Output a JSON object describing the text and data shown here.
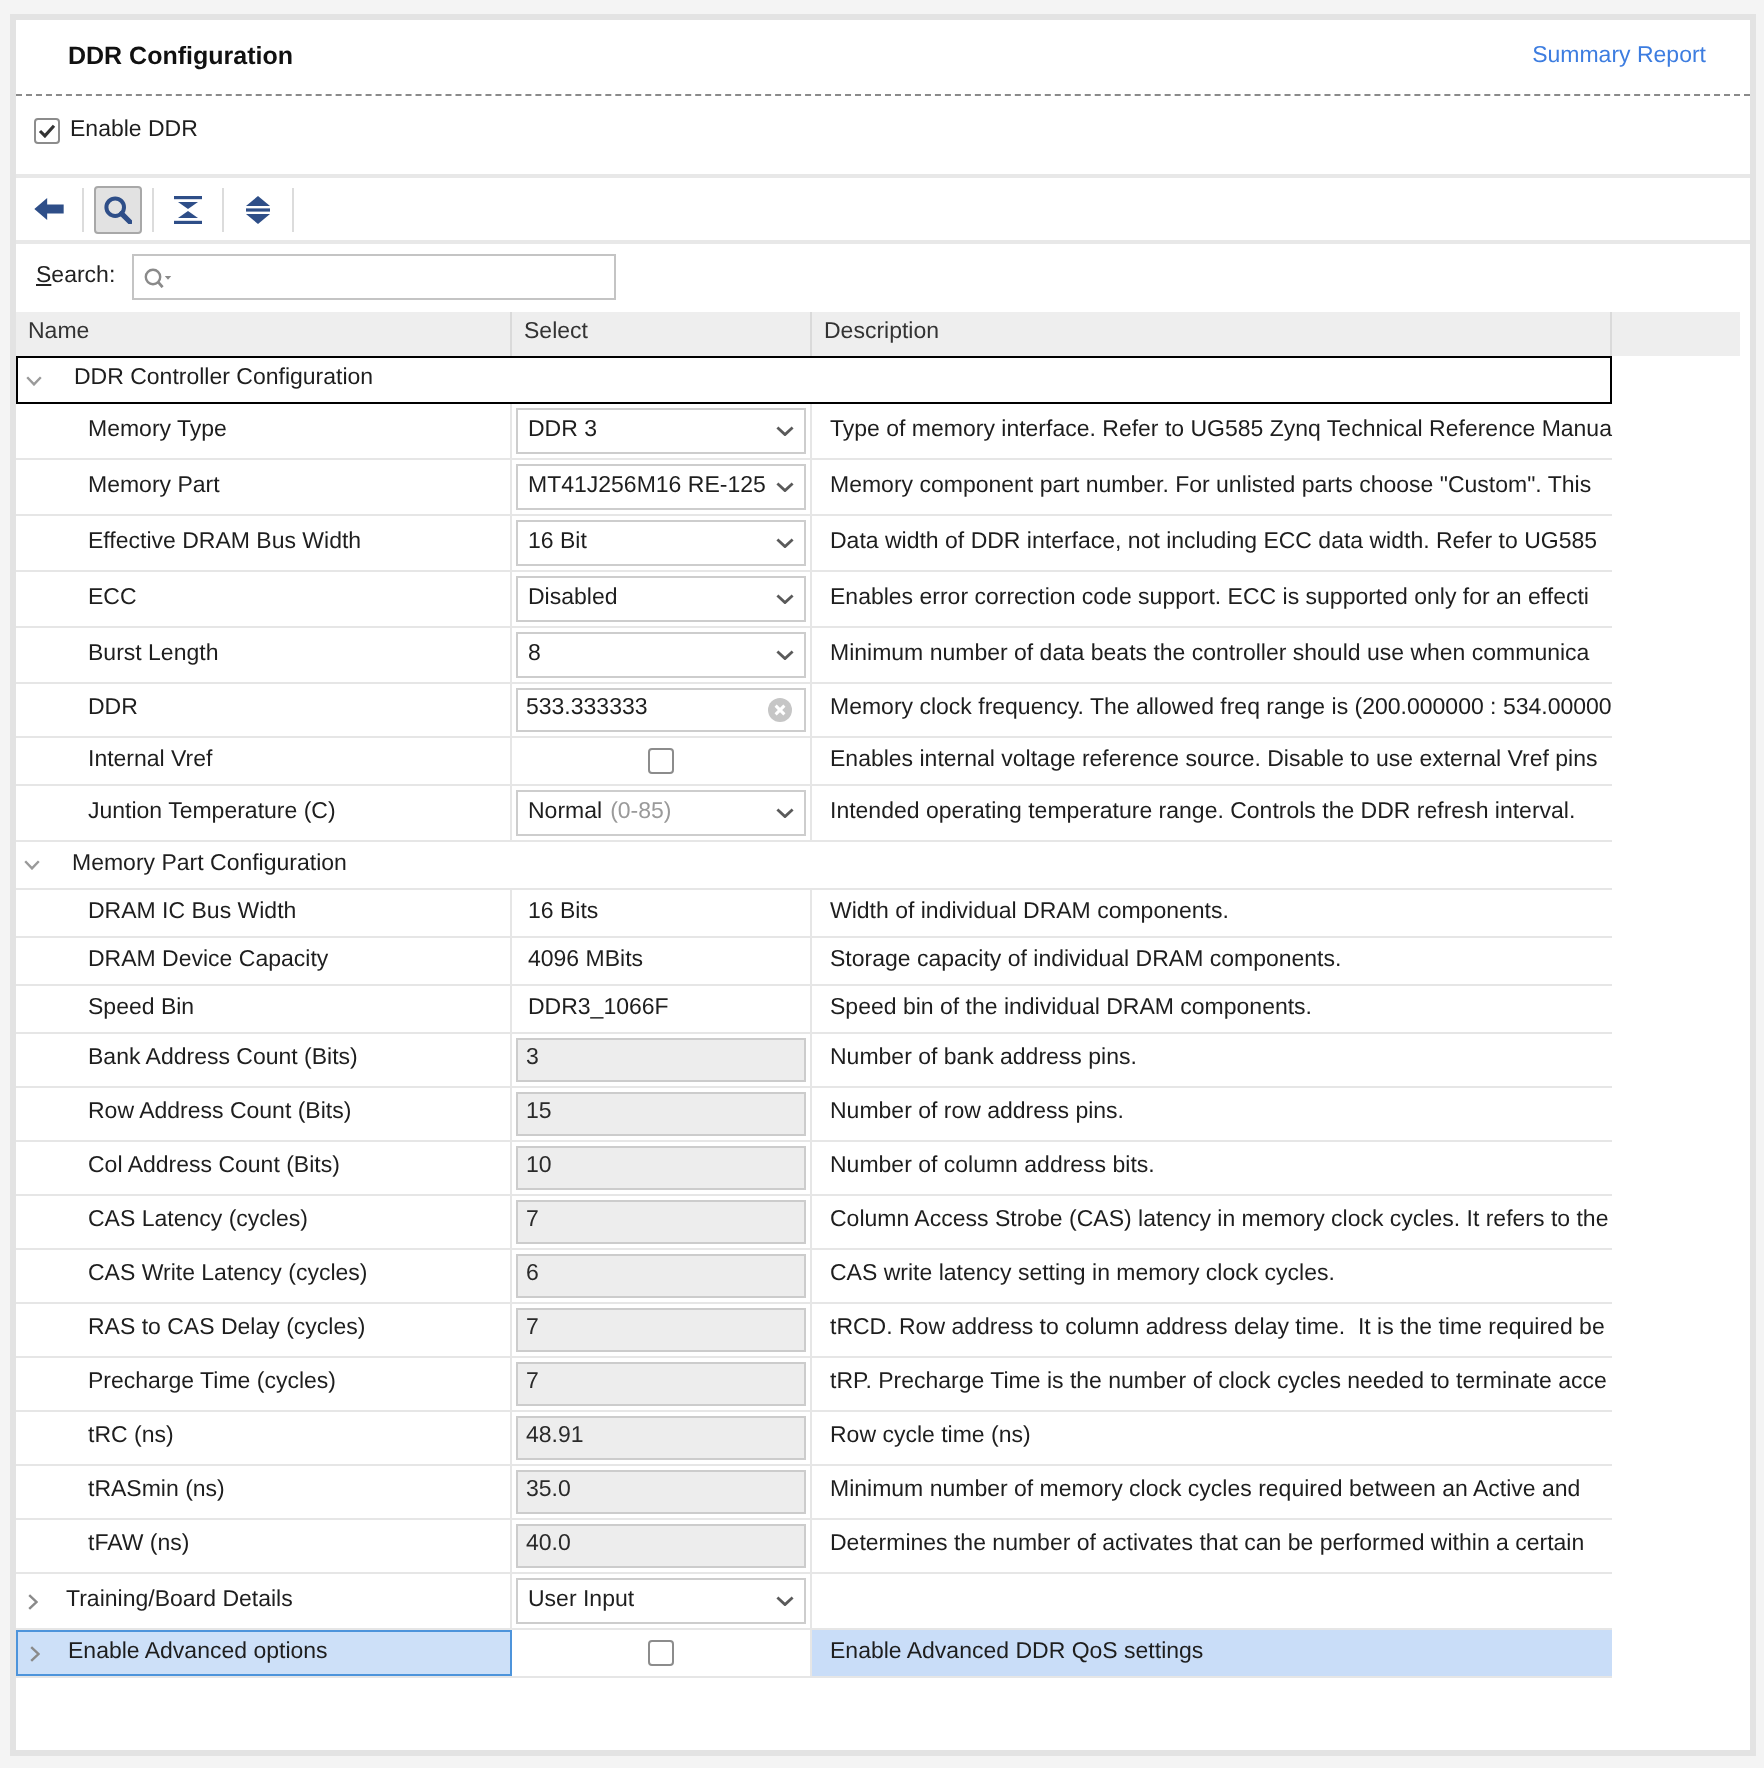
{
  "header": {
    "title": "DDR Configuration",
    "link": "Summary Report"
  },
  "enable_ddr": {
    "label": "Enable DDR",
    "checked": true
  },
  "toolbar": [
    {
      "kind": "back",
      "pressed": false
    },
    {
      "kind": "search",
      "pressed": true
    },
    {
      "kind": "collapse_all",
      "pressed": false
    },
    {
      "kind": "expand_all",
      "pressed": false
    }
  ],
  "search": {
    "label": "Search:"
  },
  "table": {
    "columns": [
      "Name",
      "Select",
      "Description"
    ],
    "rows": [
      {
        "name": "DDR Controller Configuration",
        "kind": "group",
        "expanded": true,
        "selected": false,
        "focused": true,
        "children": [
          {
            "name": "Memory Type",
            "kind": "dropdown",
            "value": "DDR 3",
            "description": "Type of memory interface. Refer to UG585 Zynq Technical Reference Manua",
            "selected": false,
            "focused": false
          },
          {
            "name": "Memory Part",
            "kind": "dropdown",
            "value": "MT41J256M16 RE-125",
            "description": "Memory component part number. For unlisted parts choose \"Custom\". This",
            "selected": false,
            "focused": false
          },
          {
            "name": "Effective DRAM Bus Width",
            "kind": "dropdown",
            "value": "16 Bit",
            "description": "Data width of DDR interface, not including ECC data width. Refer to UG585",
            "selected": false,
            "focused": false
          },
          {
            "name": "ECC",
            "kind": "dropdown",
            "value": "Disabled",
            "description": "Enables error correction code support. ECC is supported only for an effecti",
            "selected": false,
            "focused": false
          },
          {
            "name": "Burst Length",
            "kind": "dropdown",
            "value": "8",
            "description": "Minimum number of data beats the controller should use when communica",
            "selected": false,
            "focused": false
          },
          {
            "name": "DDR",
            "kind": "entry",
            "value": "533.333333",
            "description": "Memory clock frequency. The allowed freq range is (200.000000 : 534.00000",
            "selected": false,
            "focused": false
          },
          {
            "name": "Internal Vref",
            "kind": "checkbox",
            "checked": false,
            "description": "Enables internal voltage reference source. Disable to use external Vref pins",
            "selected": false,
            "focused": false
          },
          {
            "name": "Juntion Temperature (C)",
            "kind": "dropdown",
            "value": "Normal",
            "hint": "(0-85)",
            "description": "Intended operating temperature range. Controls the DDR refresh interval.",
            "selected": false,
            "focused": false
          }
        ]
      },
      {
        "name": "Memory Part Configuration",
        "kind": "group",
        "expanded": true,
        "selected": false,
        "focused": false,
        "children": [
          {
            "name": "DRAM IC Bus Width",
            "kind": "text",
            "value": "16 Bits",
            "description": "Width of individual DRAM components.",
            "selected": false,
            "focused": false
          },
          {
            "name": "DRAM Device Capacity",
            "kind": "text",
            "value": "4096 MBits",
            "description": "Storage capacity of individual DRAM components.",
            "selected": false,
            "focused": false
          },
          {
            "name": "Speed Bin",
            "kind": "text",
            "value": "DDR3_1066F",
            "description": "Speed bin of the individual DRAM components.",
            "selected": false,
            "focused": false
          },
          {
            "name": "Bank Address Count (Bits)",
            "kind": "readonly",
            "value": "3",
            "description": "Number of bank address pins.",
            "selected": false,
            "focused": false
          },
          {
            "name": "Row Address Count (Bits)",
            "kind": "readonly",
            "value": "15",
            "description": "Number of row address pins.",
            "selected": false,
            "focused": false
          },
          {
            "name": "Col Address Count (Bits)",
            "kind": "readonly",
            "value": "10",
            "description": "Number of column address bits.",
            "selected": false,
            "focused": false
          },
          {
            "name": "CAS Latency (cycles)",
            "kind": "readonly",
            "value": "7",
            "description": "Column Access Strobe (CAS) latency in memory clock cycles. It refers to the",
            "selected": false,
            "focused": false
          },
          {
            "name": "CAS Write Latency (cycles)",
            "kind": "readonly",
            "value": "6",
            "description": "CAS write latency setting in memory clock cycles.",
            "selected": false,
            "focused": false
          },
          {
            "name": "RAS to CAS Delay (cycles)",
            "kind": "readonly",
            "value": "7",
            "description": "tRCD. Row address to column address delay time.  It is the time required be",
            "selected": false,
            "focused": false
          },
          {
            "name": "Precharge Time (cycles)",
            "kind": "readonly",
            "value": "7",
            "description": "tRP. Precharge Time is the number of clock cycles needed to terminate acce",
            "selected": false,
            "focused": false
          },
          {
            "name": "tRC (ns)",
            "kind": "readonly",
            "value": "48.91",
            "description": "Row cycle time (ns)",
            "selected": false,
            "focused": false
          },
          {
            "name": "tRASmin (ns)",
            "kind": "readonly",
            "value": "35.0",
            "description": "Minimum number of memory clock cycles required between an Active and",
            "selected": false,
            "focused": false
          },
          {
            "name": "tFAW (ns)",
            "kind": "readonly",
            "value": "40.0",
            "description": "Determines the number of activates that can be performed within a certain",
            "selected": false,
            "focused": false
          }
        ]
      },
      {
        "name": "Training/Board Details",
        "kind": "dropdown",
        "value": "User Input",
        "expanded": false,
        "selected": false,
        "focused": false
      },
      {
        "name": "Enable Advanced options",
        "kind": "checkbox",
        "checked": false,
        "expanded": false,
        "selected": true,
        "focused": false,
        "description": "Enable Advanced DDR QoS settings"
      }
    ]
  }
}
